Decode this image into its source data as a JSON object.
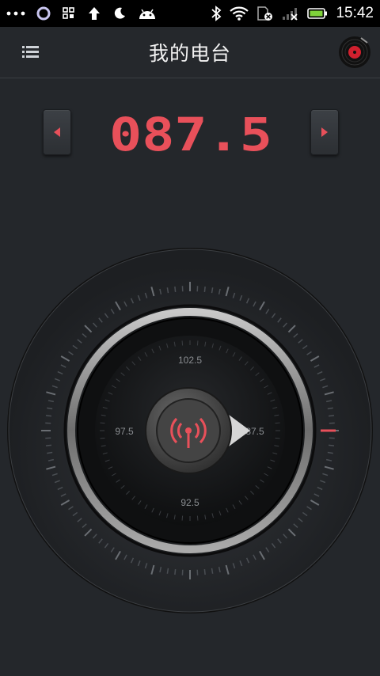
{
  "status_bar": {
    "time": "15:42",
    "left_icons": [
      "more-dots-icon",
      "circle-ring-icon",
      "grid-app-icon",
      "upload-arrow-icon",
      "moon-icon",
      "android-icon"
    ],
    "right_icons": [
      "bluetooth-icon",
      "wifi-icon",
      "sim-off-icon",
      "signal-off-icon",
      "battery-icon"
    ]
  },
  "app_bar": {
    "title": "我的电台",
    "menu_icon": "menu-list-icon",
    "record_icon": "vinyl-record-icon"
  },
  "tuner": {
    "frequency": "087.5",
    "prev_icon": "triangle-left-icon",
    "next_icon": "triangle-right-icon",
    "accent_color": "#e8505a"
  },
  "dial": {
    "labels": {
      "top": "102.5",
      "left": "97.5",
      "right": "87.5",
      "bottom": "92.5"
    },
    "center_icon": "radio-signal-icon"
  }
}
